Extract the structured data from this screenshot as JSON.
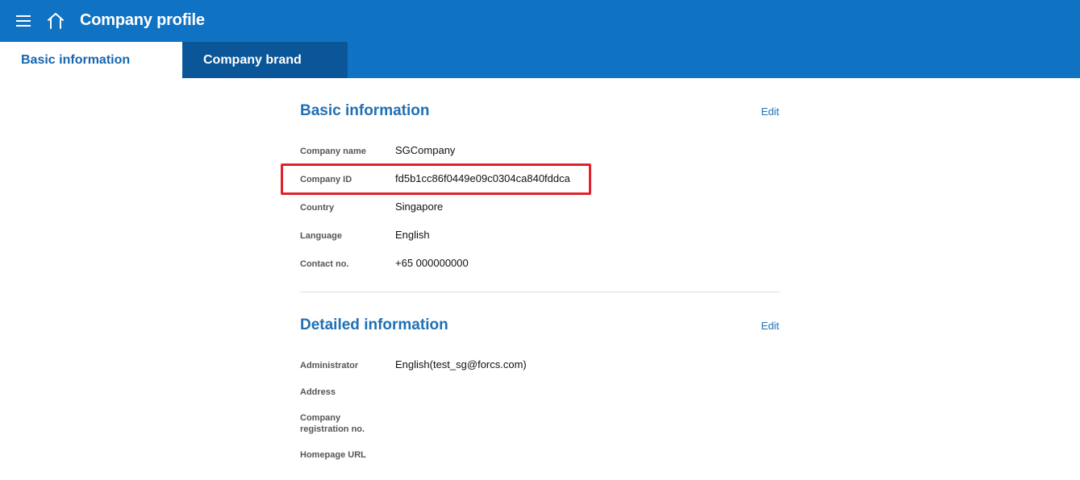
{
  "header": {
    "title": "Company profile"
  },
  "tabs": [
    {
      "label": "Basic information",
      "active": true
    },
    {
      "label": "Company brand",
      "active": false
    }
  ],
  "basic": {
    "title": "Basic information",
    "edit_label": "Edit",
    "fields": [
      {
        "label": "Company name",
        "value": "SGCompany"
      },
      {
        "label": "Company ID",
        "value": "fd5b1cc86f0449e09c0304ca840fddca"
      },
      {
        "label": "Country",
        "value": "Singapore"
      },
      {
        "label": "Language",
        "value": "English"
      },
      {
        "label": "Contact no.",
        "value": "+65 000000000"
      }
    ]
  },
  "detailed": {
    "title": "Detailed information",
    "edit_label": "Edit",
    "fields": [
      {
        "label": "Administrator",
        "value": "English(test_sg@forcs.com)"
      },
      {
        "label": "Address",
        "value": ""
      },
      {
        "label": "Company\nregistration no.",
        "value": ""
      },
      {
        "label": "Homepage URL",
        "value": ""
      }
    ]
  },
  "colors": {
    "header_bg": "#1072c3",
    "tab_inactive_bg": "#0a5699",
    "accent": "#1f6fb5",
    "highlight_border": "#e0212b"
  },
  "icons": [
    "menu-icon",
    "home-icon"
  ]
}
